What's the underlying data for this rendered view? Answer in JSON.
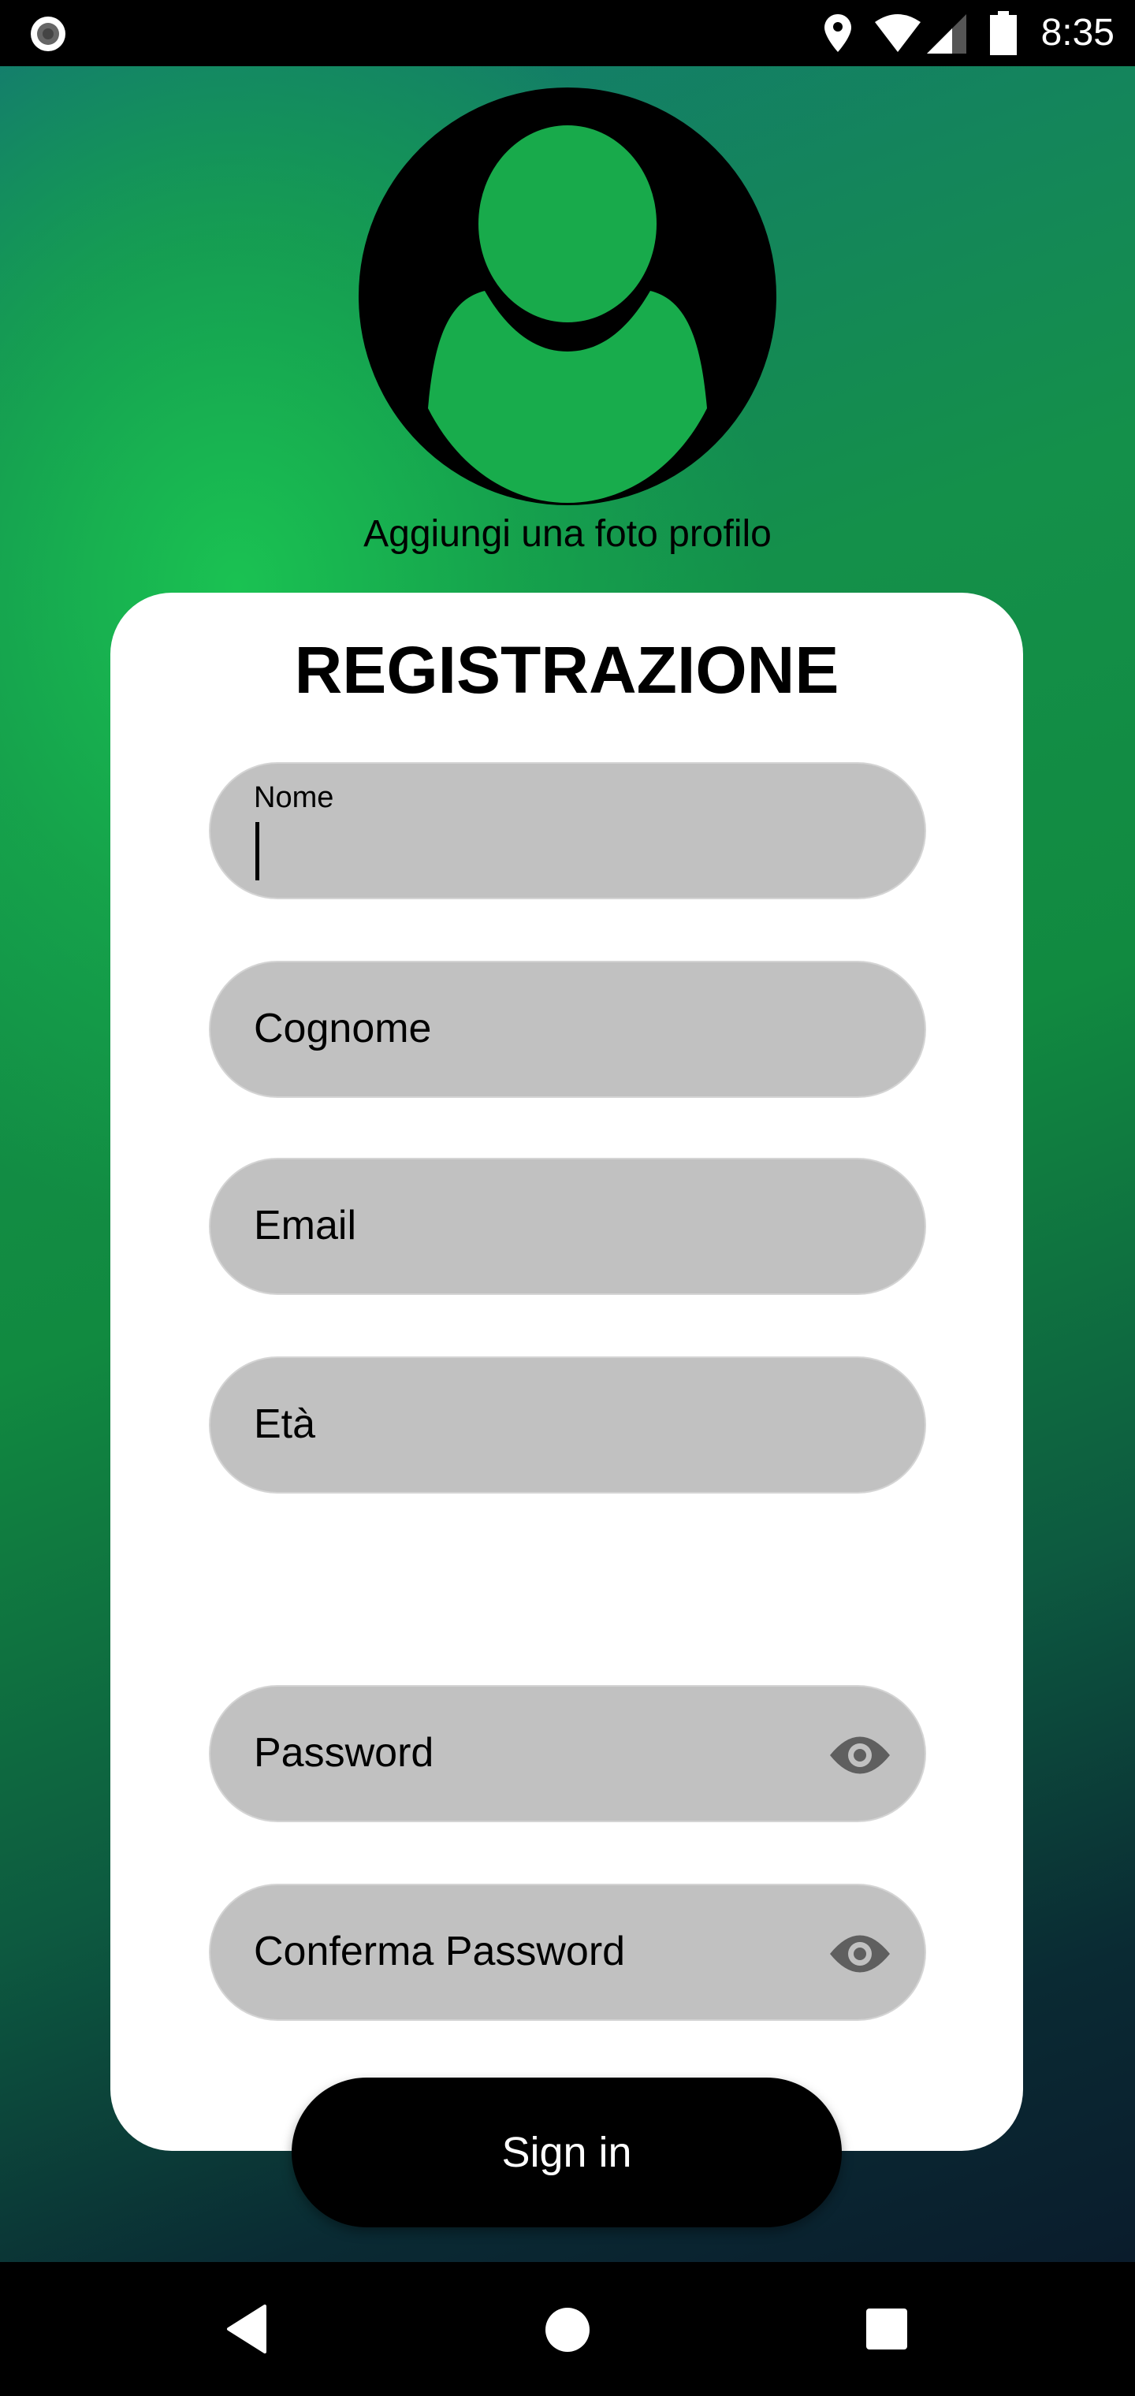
{
  "status_bar": {
    "time": "8:35",
    "icons": [
      "record-icon",
      "location-icon",
      "wifi-icon",
      "signal-icon",
      "battery-icon"
    ]
  },
  "profile": {
    "add_photo_label": "Aggiungi una foto profilo"
  },
  "form": {
    "title": "REGISTRAZIONE",
    "fields": [
      {
        "label": "Nome",
        "value": ""
      },
      {
        "placeholder": "Cognome"
      },
      {
        "placeholder": "Email"
      },
      {
        "placeholder": "Età"
      },
      {
        "placeholder": "Password"
      },
      {
        "placeholder": "Conferma Password"
      }
    ],
    "submit_label": "Sign in"
  },
  "colors": {
    "field_bg": "#c1c1c1",
    "accent_green": "#1abf50",
    "button": "#000000"
  }
}
